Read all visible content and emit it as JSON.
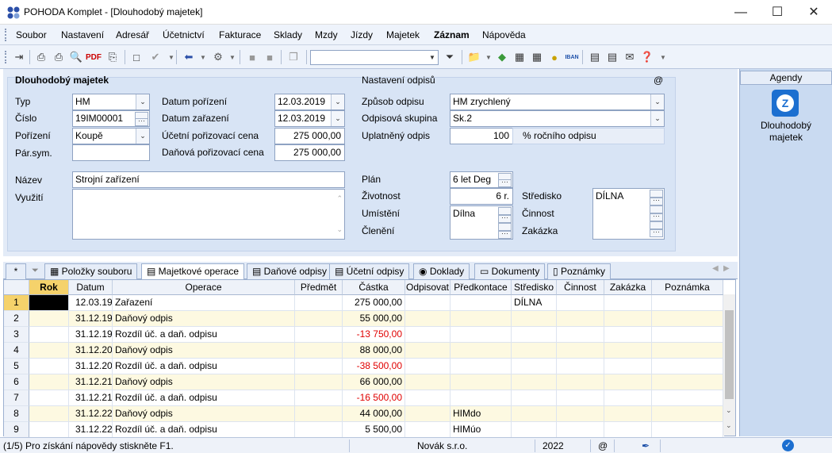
{
  "window": {
    "title": "POHODA Komplet - [Dlouhodobý majetek]"
  },
  "menu": [
    "Soubor",
    "Nastavení",
    "Adresář",
    "Účetnictví",
    "Fakturace",
    "Sklady",
    "Mzdy",
    "Jízdy",
    "Majetek",
    "Záznam",
    "Nápověda"
  ],
  "toolbar": {
    "icons": [
      "exit-icon",
      "print-preview-icon",
      "print-icon",
      "preview-icon",
      "pdf-icon",
      "export-icon",
      "new-record-icon",
      "check-icon",
      "back-arrow-icon",
      "settings-icon",
      "lock-icon",
      "unlock-icon",
      "copy-icon",
      "filter-icon",
      "folder-icon",
      "money-icon",
      "calendar-icon",
      "calculator-icon",
      "coins-icon",
      "iban-icon",
      "note-icon",
      "message-icon",
      "email-icon",
      "help-icon"
    ],
    "combo_value": ""
  },
  "form": {
    "section_title": "Dlouhodobý majetek",
    "typ_label": "Typ",
    "typ_value": "HM",
    "cislo_label": "Číslo",
    "cislo_value": "19IM00001",
    "porizeni_label": "Pořízení",
    "porizeni_value": "Koupě",
    "parsym_label": "Pár.sym.",
    "parsym_value": "",
    "datum_porizeni_label": "Datum pořízení",
    "datum_porizeni_value": "12.03.2019",
    "datum_zarazeni_label": "Datum zařazení",
    "datum_zarazeni_value": "12.03.2019",
    "ucetni_cena_label": "Účetní pořizovací cena",
    "ucetni_cena_value": "275 000,00",
    "danova_cena_label": "Daňová pořizovací cena",
    "danova_cena_value": "275 000,00",
    "nazev_label": "Název",
    "nazev_value": "Strojní zařízení",
    "vyuziti_label": "Využití",
    "vyuziti_value": "",
    "odpisy_title": "Nastavení odpisů",
    "at_sign": "@",
    "zpusob_label": "Způsob odpisu",
    "zpusob_value": "HM zrychlený",
    "skupina_label": "Odpisová skupina",
    "skupina_value": "Sk.2",
    "uplatneny_label": "Uplatněný odpis",
    "uplatneny_value": "100",
    "uplatneny_unit": "% ročního odpisu",
    "plan_label": "Plán",
    "plan_value": "6 let Deg",
    "zivotnost_label": "Životnost",
    "zivotnost_value": "6 r.",
    "umisteni_label": "Umístění",
    "umisteni_value": "Dílna",
    "cleneni_label": "Členění",
    "cleneni_value": "",
    "stredisko_label": "Středisko",
    "stredisko_value": "DÍLNA",
    "cinnost_label": "Činnost",
    "zakazka_label": "Zakázka"
  },
  "tabs": [
    "Položky souboru",
    "Majetkové operace",
    "Daňové odpisy",
    "Účetní odpisy",
    "Doklady",
    "Dokumenty",
    "Poznámky"
  ],
  "tabs_active": "Majetkové operace",
  "tab_star": "*",
  "grid": {
    "headers": [
      "Rok",
      "Datum",
      "Operace",
      "Předmět",
      "Částka",
      "Odpisovat",
      "Předkontace",
      "Středisko",
      "Činnost",
      "Zakázka",
      "Poznámka"
    ],
    "rows": [
      {
        "n": "1",
        "rok": "",
        "datum": "12.03.19",
        "operace": "Zařazení",
        "predmet": "",
        "castka": "275 000,00",
        "neg": false,
        "odpisovat": "",
        "predkontace": "",
        "stredisko": "DÍLNA"
      },
      {
        "n": "2",
        "rok": "",
        "datum": "31.12.19",
        "operace": "Daňový odpis",
        "predmet": "",
        "castka": "55 000,00",
        "neg": false,
        "odpisovat": "",
        "predkontace": "",
        "stredisko": ""
      },
      {
        "n": "3",
        "rok": "",
        "datum": "31.12.19",
        "operace": "Rozdíl úč. a daň. odpisu",
        "predmet": "",
        "castka": "-13 750,00",
        "neg": true,
        "odpisovat": "",
        "predkontace": "",
        "stredisko": ""
      },
      {
        "n": "4",
        "rok": "",
        "datum": "31.12.20",
        "operace": "Daňový odpis",
        "predmet": "",
        "castka": "88 000,00",
        "neg": false,
        "odpisovat": "",
        "predkontace": "",
        "stredisko": ""
      },
      {
        "n": "5",
        "rok": "",
        "datum": "31.12.20",
        "operace": "Rozdíl úč. a daň. odpisu",
        "predmet": "",
        "castka": "-38 500,00",
        "neg": true,
        "odpisovat": "",
        "predkontace": "",
        "stredisko": ""
      },
      {
        "n": "6",
        "rok": "",
        "datum": "31.12.21",
        "operace": "Daňový odpis",
        "predmet": "",
        "castka": "66 000,00",
        "neg": false,
        "odpisovat": "",
        "predkontace": "",
        "stredisko": ""
      },
      {
        "n": "7",
        "rok": "",
        "datum": "31.12.21",
        "operace": "Rozdíl úč. a daň. odpisu",
        "predmet": "",
        "castka": "-16 500,00",
        "neg": true,
        "odpisovat": "",
        "predkontace": "",
        "stredisko": ""
      },
      {
        "n": "8",
        "rok": "",
        "datum": "31.12.22",
        "operace": "Daňový odpis",
        "predmet": "",
        "castka": "44 000,00",
        "neg": false,
        "odpisovat": "",
        "predkontace": "HIMdo",
        "stredisko": ""
      },
      {
        "n": "9",
        "rok": "",
        "datum": "31.12.22",
        "operace": "Rozdíl úč. a daň. odpisu",
        "predmet": "",
        "castka": "5 500,00",
        "neg": false,
        "odpisovat": "",
        "predkontace": "HIMúo",
        "stredisko": ""
      }
    ]
  },
  "agendy": {
    "title": "Agendy",
    "item_label": "Dlouhodobý majetek"
  },
  "status": {
    "help": "(1/5) Pro získání nápovědy stiskněte F1.",
    "company": "Novák s.r.o.",
    "year": "2022",
    "at": "@"
  },
  "colors": {
    "accent": "#1c6fd0",
    "row_alt": "#fdf9e1",
    "negative": "#e00000",
    "panel": "#d8e4f5"
  }
}
